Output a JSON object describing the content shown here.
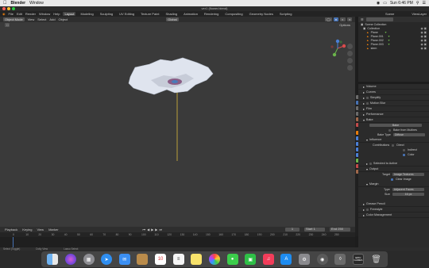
{
  "mac_menubar": {
    "app_name": "Blender",
    "menu_window": "Window",
    "clock": "Sun 6:46 PM"
  },
  "window": {
    "title": "ver1 (flower.blend)"
  },
  "blender_menu": [
    "File",
    "Edit",
    "Render",
    "Window",
    "Help"
  ],
  "workspaces": [
    "Layout",
    "Modeling",
    "Sculpting",
    "UV Editing",
    "Texture Paint",
    "Shading",
    "Animation",
    "Rendering",
    "Compositing",
    "Geometry Nodes",
    "Scripting"
  ],
  "active_workspace": "Layout",
  "scene_label": "Scene",
  "view_layer_label": "ViewLayer",
  "viewport_header": {
    "mode": "Object Mode",
    "menus": [
      "View",
      "Select",
      "Add",
      "Object"
    ],
    "transform": "Global",
    "options": "Options"
  },
  "outliner": {
    "root": "Scene Collection",
    "collection": "Collection",
    "items": [
      "Plane",
      "Plane.001",
      "Plane.002",
      "Plane.003",
      "stem"
    ]
  },
  "properties": {
    "sections_top": [
      "Volume",
      "Curves",
      "Simplify",
      "Motion Blur",
      "Film",
      "Performance",
      "Bake"
    ],
    "bake_button": "Bake",
    "multires": "Bake from Multires",
    "bake_type_label": "Bake Type",
    "bake_type_value": "Diffuse",
    "influence": "Influence",
    "contributions_label": "Contributions",
    "contrib_direct": "Direct",
    "contrib_indirect": "Indirect",
    "contrib_color": "Color",
    "selected_to_active": "Selected to Active",
    "output": "Output",
    "target_label": "Target",
    "target_value": "Image Textures",
    "clear_image": "Clear Image",
    "margin": "Margin",
    "type_label": "Type",
    "type_value": "Adjacent Faces",
    "size_label": "Size",
    "size_value": "16 px",
    "sections_bottom": [
      "Grease Pencil",
      "Freestyle",
      "Color Management"
    ]
  },
  "timeline": {
    "menus": [
      "Playback",
      "Keying",
      "View",
      "Marker"
    ],
    "current_frame": "1",
    "start_label": "Start",
    "start_value": "1",
    "end_label": "End",
    "end_value": "250",
    "ticks": [
      "0",
      "10",
      "20",
      "30",
      "40",
      "50",
      "60",
      "70",
      "80",
      "90",
      "100",
      "110",
      "120",
      "130",
      "140",
      "150",
      "160",
      "170",
      "180",
      "190",
      "200",
      "210",
      "220",
      "230",
      "240",
      "250"
    ]
  },
  "status_bar": [
    "Select (Toggle)",
    "Dolly View",
    "Lasso Select"
  ],
  "dock_apps": [
    "Finder",
    "Siri",
    "Launchpad",
    "Safari",
    "Mail",
    "Notes",
    "Calendar",
    "Reminders",
    "Stickies",
    "Photos",
    "Messages",
    "FaceTime",
    "Music",
    "App Store",
    "System Preferences",
    "Blender",
    "Unity",
    "Epic Games",
    "Trash"
  ],
  "dock_calendar_day": "10",
  "dock_epic_label": "EPIC GAMES",
  "colors": {
    "accent": "#4772b3",
    "orange": "#e87d0d",
    "viewport_bg": "#3a3a3a"
  }
}
